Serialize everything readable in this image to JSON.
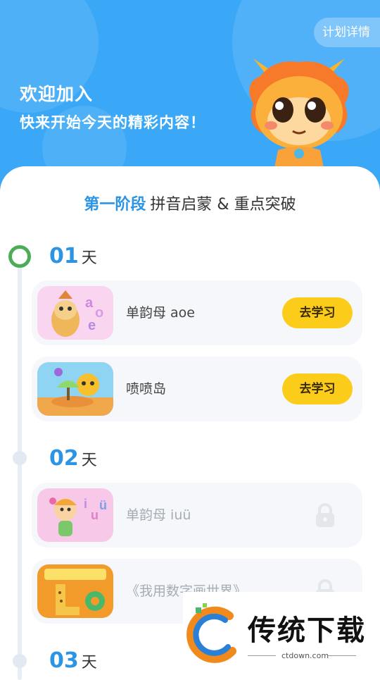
{
  "header": {
    "plan_label": "计划详情",
    "greeting_line1": "欢迎加入",
    "greeting_line2": "快来开始今天的精彩内容！",
    "bg_color": "#3aa7f7"
  },
  "stage": {
    "highlight": "第一阶段",
    "title": "拼音启蒙 & 重点突破"
  },
  "days": [
    {
      "num": "01",
      "unit": "天",
      "lessons": [
        {
          "title": "单韵母 aoe",
          "action": "去学习",
          "locked": false
        },
        {
          "title": "喷喷岛",
          "action": "去学习",
          "locked": false
        }
      ]
    },
    {
      "num": "02",
      "unit": "天",
      "lessons": [
        {
          "title": "单韵母 iuü",
          "locked": true
        },
        {
          "title": "《我用数字画世界》",
          "locked": true
        }
      ]
    },
    {
      "num": "03",
      "unit": "天",
      "lessons": []
    }
  ],
  "watermark": {
    "name": "传统下载",
    "domain": "ctdown.com"
  },
  "colors": {
    "accent": "#2b94e4",
    "button": "#fbcd1a",
    "active_dot": "#4cad59"
  }
}
